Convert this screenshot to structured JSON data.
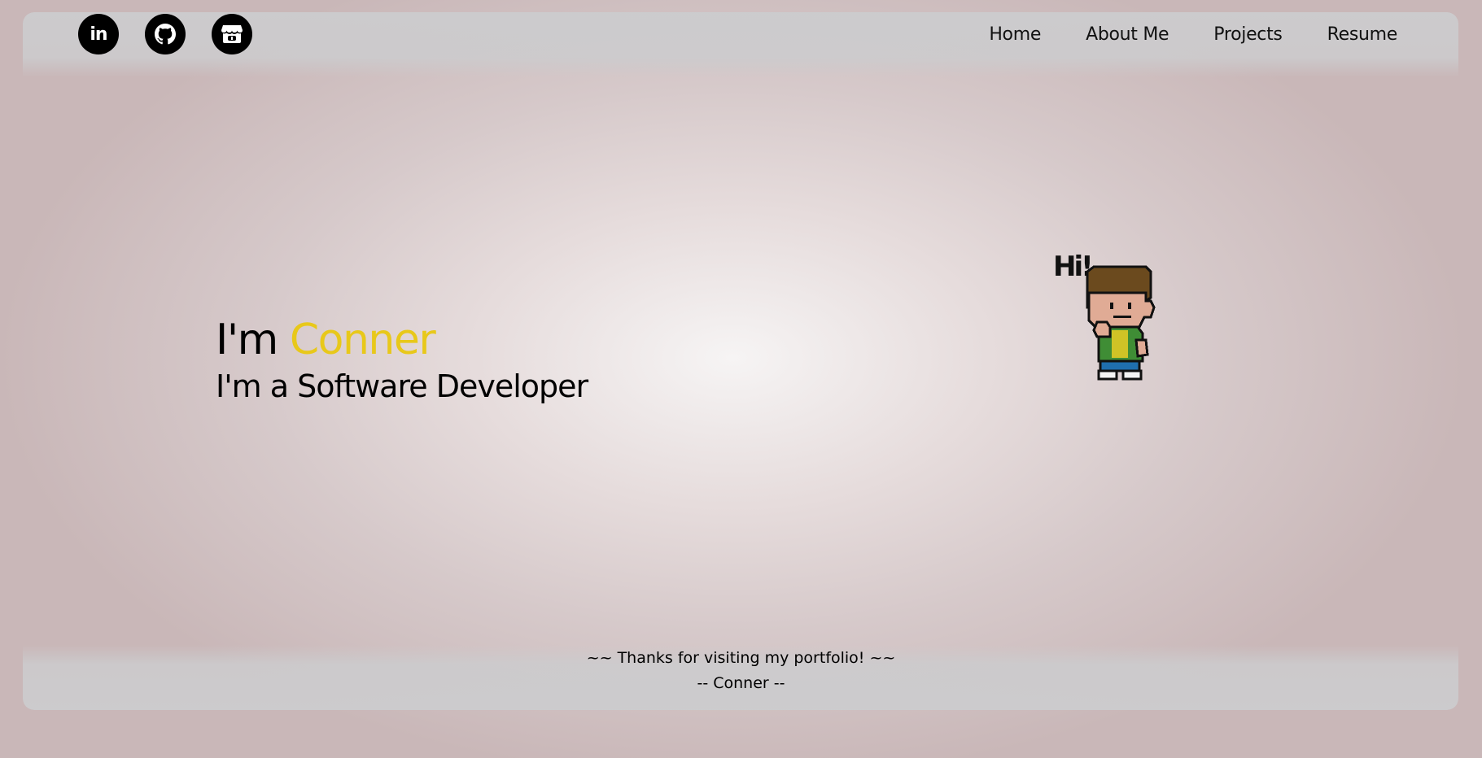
{
  "header": {
    "social": [
      {
        "icon": "linkedin-icon",
        "label": "in"
      },
      {
        "icon": "github-icon"
      },
      {
        "icon": "itchio-icon"
      }
    ],
    "nav": [
      "Home",
      "About Me",
      "Projects",
      "Resume"
    ]
  },
  "hero": {
    "greeting_prefix": "I'm ",
    "name": "Conner",
    "subtitle": "I'm a Software Developer"
  },
  "avatar": {
    "speech": "Hi!"
  },
  "footer": {
    "line1": "~~ Thanks for visiting my portfolio! ~~",
    "line2": "-- Conner --"
  },
  "colors": {
    "accent": "#e8c81a",
    "text": "#000000",
    "icon_bg": "#000000"
  }
}
